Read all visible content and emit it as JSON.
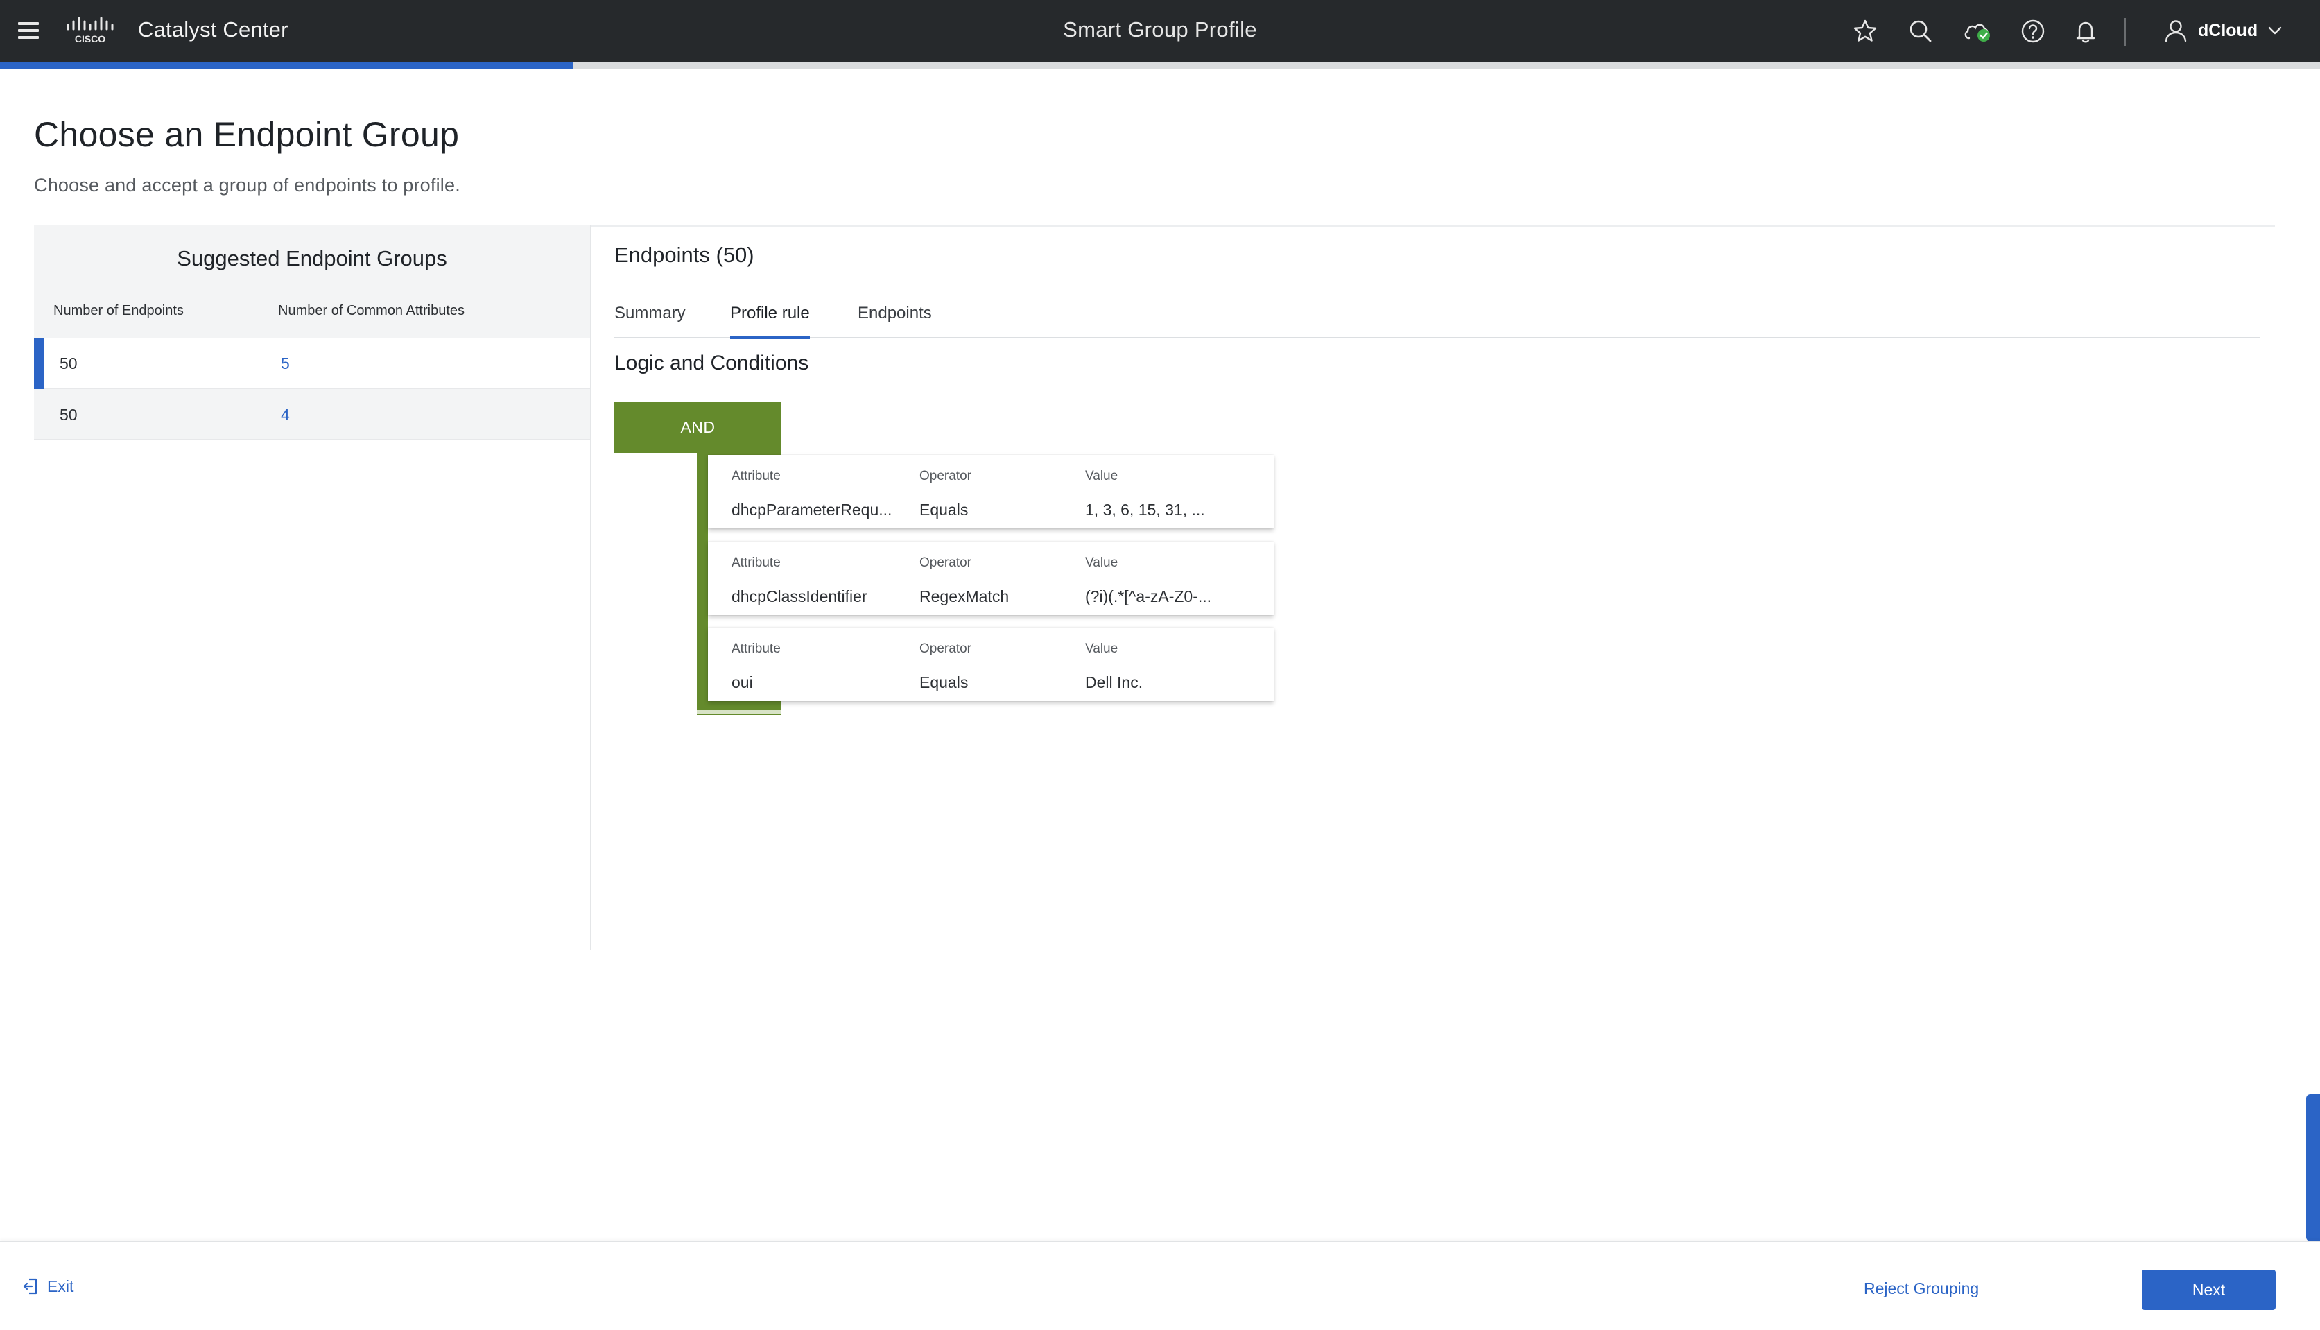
{
  "header": {
    "app_title": "Catalyst Center",
    "logo_text": "CISCO",
    "page_title": "Smart Group Profile",
    "user_name": "dCloud",
    "progress_percent": 24.7
  },
  "page": {
    "title": "Choose an Endpoint Group",
    "subtitle": "Choose and accept a group of endpoints to profile."
  },
  "suggested": {
    "title": "Suggested Endpoint Groups",
    "col_endpoints": "Number of Endpoints",
    "col_attributes": "Number of Common Attributes",
    "rows": [
      {
        "endpoints": "50",
        "attributes": "5",
        "selected": true
      },
      {
        "endpoints": "50",
        "attributes": "4",
        "selected": false
      }
    ]
  },
  "detail": {
    "title": "Endpoints (50)",
    "tabs": [
      {
        "label": "Summary",
        "active": false
      },
      {
        "label": "Profile rule",
        "active": true
      },
      {
        "label": "Endpoints",
        "active": false
      }
    ],
    "logic_title": "Logic and Conditions",
    "logic_operator": "AND",
    "attr_label": "Attribute",
    "op_label": "Operator",
    "value_label": "Value",
    "conditions": [
      {
        "attribute": "dhcpParameterRequ...",
        "operator": "Equals",
        "value": "1, 3, 6, 15, 31, ..."
      },
      {
        "attribute": "dhcpClassIdentifier",
        "operator": "RegexMatch",
        "value": "(?i)(.*[^a-zA-Z0-..."
      },
      {
        "attribute": "oui",
        "operator": "Equals",
        "value": "Dell Inc."
      }
    ]
  },
  "footer": {
    "exit_label": "Exit",
    "reject_label": "Reject Grouping",
    "next_label": "Next"
  },
  "icons": [
    "menu-icon",
    "cisco-logo",
    "star-icon",
    "search-icon",
    "cloud-status-icon",
    "help-icon",
    "bell-icon",
    "user-icon",
    "chevron-down-icon",
    "exit-icon"
  ],
  "colors": {
    "accent": "#2b64c6",
    "logic_green": "#648a2c",
    "header_bg": "#26292c",
    "status_green": "#3fae49"
  }
}
